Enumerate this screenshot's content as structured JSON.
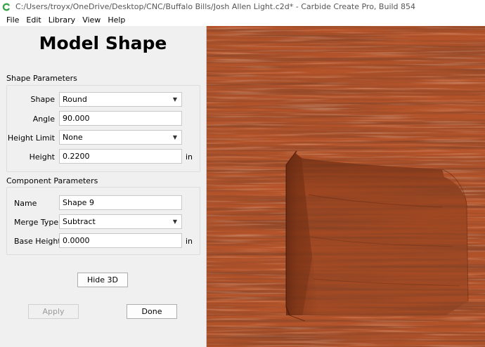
{
  "window": {
    "title": "C:/Users/troyx/OneDrive/Desktop/CNC/Buffalo Bills/Josh Allen Light.c2d* - Carbide Create Pro, Build 854",
    "icon": "carbide-create-icon"
  },
  "menu": [
    "File",
    "Edit",
    "Library",
    "View",
    "Help"
  ],
  "panel": {
    "title": "Model Shape",
    "shape_parameters": {
      "section_title": "Shape Parameters",
      "shape_label": "Shape",
      "shape_value": "Round",
      "angle_label": "Angle",
      "angle_value": "90.000",
      "height_limit_label": "Height Limit",
      "height_limit_value": "None",
      "height_label": "Height",
      "height_value": "0.2200",
      "height_unit": "in"
    },
    "component_parameters": {
      "section_title": "Component Parameters",
      "name_label": "Name",
      "name_value": "Shape 9",
      "merge_type_label": "Merge Type",
      "merge_type_value": "Subtract",
      "base_height_label": "Base Height",
      "base_height_value": "0.0000",
      "base_height_unit": "in"
    },
    "hide3d_label": "Hide 3D",
    "apply_label": "Apply",
    "done_label": "Done"
  },
  "colors": {
    "wood_base": "#b4532a",
    "wood_dark": "#7a2f14",
    "wood_light": "#d27a4a",
    "accent_icon": "#3aa34a"
  }
}
